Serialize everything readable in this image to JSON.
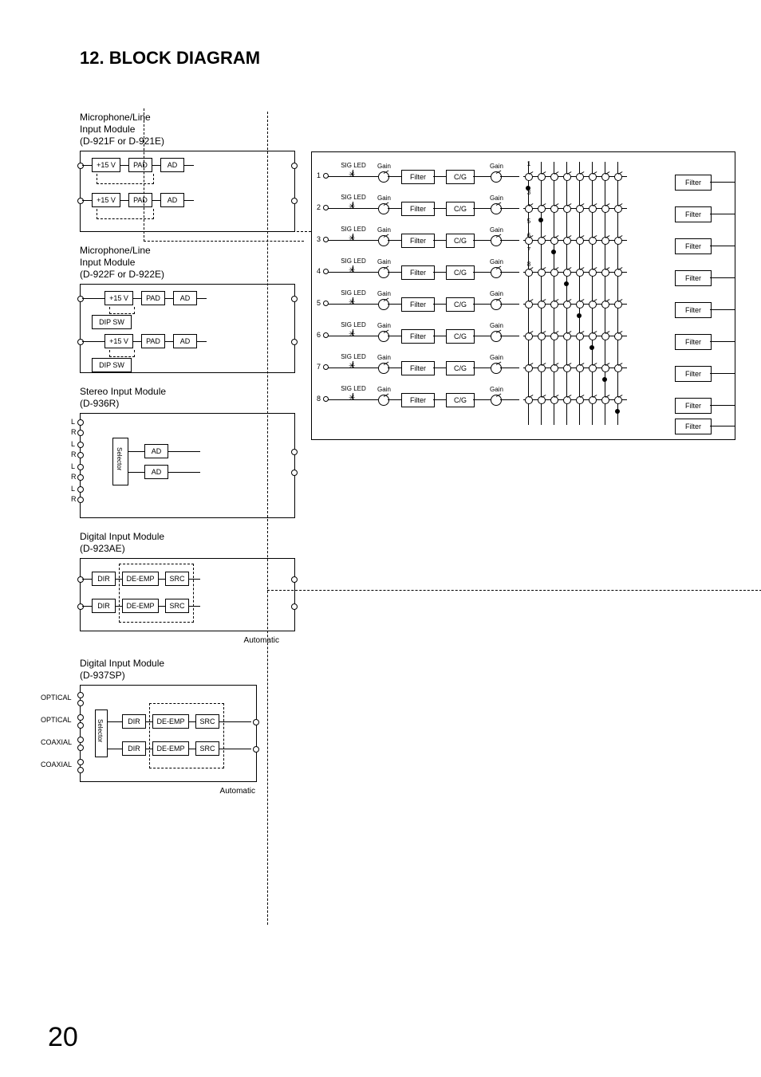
{
  "page_number": "20",
  "heading": "12. BLOCK DIAGRAM",
  "modules": {
    "mic_line_1": {
      "title_l1": "Microphone/Line",
      "title_l2": "Input Module",
      "title_l3": "(D-921F or D-921E)",
      "v": "+15 V",
      "pad": "PAD",
      "ad": "AD"
    },
    "mic_line_2": {
      "title_l1": "Microphone/Line",
      "title_l2": "Input Module",
      "title_l3": "(D-922F or D-922E)",
      "v": "+15 V",
      "pad": "PAD",
      "ad": "AD",
      "dipsw": "DIP SW"
    },
    "stereo": {
      "title_l1": "Stereo Input Module",
      "title_l2": "(D-936R)",
      "l": "L",
      "r": "R",
      "sel": "Selector",
      "ad": "AD"
    },
    "digital_1": {
      "title_l1": "Digital Input Module",
      "title_l2": "(D-923AE)",
      "dir": "DIR",
      "deemp": "DE-EMP",
      "src": "SRC",
      "auto": "Automatic"
    },
    "digital_2": {
      "title_l1": "Digital Input Module",
      "title_l2": "(D-937SP)",
      "dir": "DIR",
      "deemp": "DE-EMP",
      "src": "SRC",
      "auto": "Automatic",
      "sel": "Selector",
      "opt": "OPTICAL",
      "coax": "COAXIAL"
    }
  },
  "dsp": {
    "sigled": "SIG LED",
    "gain": "Gain",
    "filter": "Filter",
    "cg": "C/G",
    "channels": [
      "1",
      "2",
      "3",
      "4",
      "5",
      "6",
      "7",
      "8"
    ],
    "matrix_headers": [
      "1",
      "2",
      "3",
      "4",
      "5",
      "6",
      "7",
      "8"
    ],
    "out_filter": "Filter"
  },
  "chart_data": {
    "type": "block-diagram",
    "inputs": [
      {
        "module": "D-921F / D-921E",
        "channels": 2,
        "blocks": [
          "+15 V",
          "PAD",
          "AD"
        ]
      },
      {
        "module": "D-922F / D-922E",
        "channels": 2,
        "blocks": [
          "+15 V",
          "PAD",
          "AD"
        ],
        "extra": [
          "DIP SW"
        ]
      },
      {
        "module": "D-936R",
        "channels": 2,
        "stereo_pairs": 4,
        "blocks": [
          "Selector",
          "AD"
        ]
      },
      {
        "module": "D-923AE",
        "channels": 2,
        "blocks": [
          "DIR",
          "DE-EMP",
          "SRC"
        ],
        "note": "Automatic"
      },
      {
        "module": "D-937SP",
        "channels": 2,
        "blocks": [
          "Selector",
          "DIR",
          "DE-EMP",
          "SRC"
        ],
        "inputs": [
          "OPTICAL",
          "OPTICAL",
          "COAXIAL",
          "COAXIAL"
        ],
        "note": "Automatic"
      }
    ],
    "dsp_channels": 8,
    "per_channel_chain": [
      "SIG LED",
      "Gain",
      "Filter",
      "C/G",
      "Gain"
    ],
    "matrix": "8x8 crosspoint",
    "outputs": 8,
    "per_output_chain": [
      "Filter"
    ]
  }
}
